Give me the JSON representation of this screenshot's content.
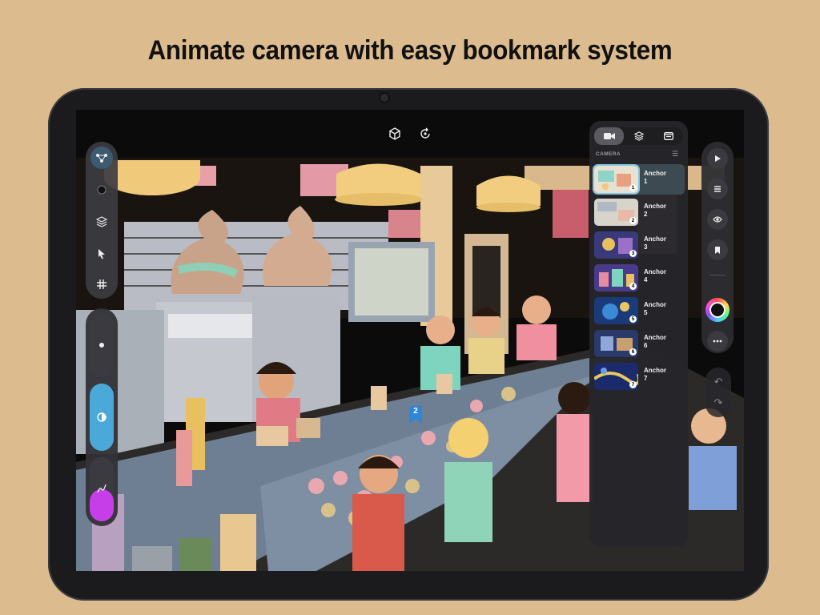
{
  "headline": "Animate camera with easy bookmark system",
  "top_toolbar": {
    "icons": [
      "cube-icon",
      "rotate-icon"
    ]
  },
  "left_toolbar": {
    "tools": [
      "share-nodes-icon",
      "brush-dot-icon",
      "layers-icon",
      "pointer-icon",
      "grid-icon"
    ],
    "active_tool_color": "#3d5a73"
  },
  "left_slider": {
    "segments": [
      "size-dot-icon",
      "opacity-icon",
      "pen-icon"
    ],
    "opacity_color": "#4aa9d8",
    "pen_color": "#c53ee8"
  },
  "right_toolbar": {
    "buttons": [
      "play-icon",
      "list-icon",
      "eye-icon",
      "bookmark-icon"
    ],
    "color_ring": "color-wheel-icon",
    "more": "more-icon"
  },
  "undo": {
    "undo": "undo-icon",
    "redo": "redo-icon"
  },
  "camera_panel": {
    "tabs": [
      "camera-icon",
      "layers-icon",
      "window-icon"
    ],
    "active_tab": 0,
    "section_label": "CAMERA",
    "anchors": [
      {
        "label": "Anchor\n1",
        "number": "1",
        "selected": true
      },
      {
        "label": "Anchor\n2",
        "number": "2",
        "selected": false
      },
      {
        "label": "Anchor\n3",
        "number": "3",
        "selected": false
      },
      {
        "label": "Anchor\n4",
        "number": "4",
        "selected": false
      },
      {
        "label": "Anchor\n5",
        "number": "5",
        "selected": false
      },
      {
        "label": "Anchor\n6",
        "number": "6",
        "selected": false
      },
      {
        "label": "Anchor\n7",
        "number": "7",
        "selected": false
      }
    ]
  },
  "scene_marker": {
    "number": "2",
    "color": "#2e86d9"
  }
}
